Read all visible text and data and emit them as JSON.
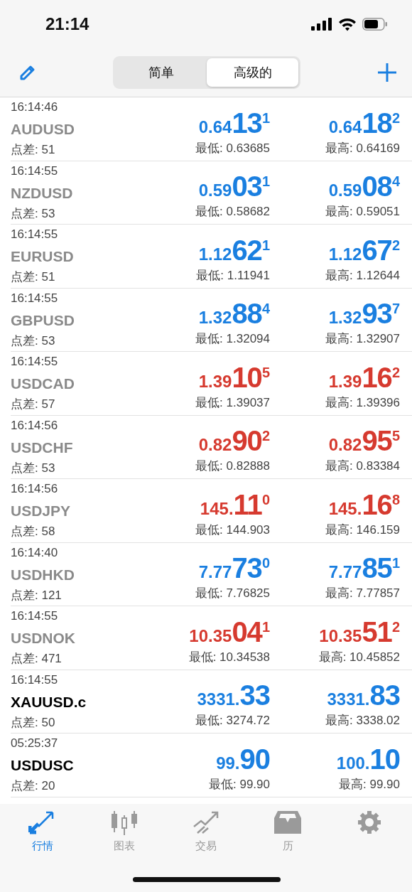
{
  "status_bar": {
    "time": "21:14"
  },
  "segments": [
    {
      "label": "简单",
      "selected": false
    },
    {
      "label": "高级的",
      "selected": true
    }
  ],
  "quotes": [
    {
      "time": "16:14:46",
      "symbol": "AUDUSD",
      "active": false,
      "spread": "点差: 51",
      "bid": {
        "color": "#1a7fe0",
        "prefix": "0.64",
        "big": "13",
        "sup": "1"
      },
      "ask": {
        "color": "#1a7fe0",
        "prefix": "0.64",
        "big": "18",
        "sup": "2"
      },
      "low": "最低: 0.63685",
      "high": "最高: 0.64169"
    },
    {
      "time": "16:14:55",
      "symbol": "NZDUSD",
      "active": false,
      "spread": "点差: 53",
      "bid": {
        "color": "#1a7fe0",
        "prefix": "0.59",
        "big": "03",
        "sup": "1"
      },
      "ask": {
        "color": "#1a7fe0",
        "prefix": "0.59",
        "big": "08",
        "sup": "4"
      },
      "low": "最低: 0.58682",
      "high": "最高: 0.59051"
    },
    {
      "time": "16:14:55",
      "symbol": "EURUSD",
      "active": false,
      "spread": "点差: 51",
      "bid": {
        "color": "#1a7fe0",
        "prefix": "1.12",
        "big": "62",
        "sup": "1"
      },
      "ask": {
        "color": "#1a7fe0",
        "prefix": "1.12",
        "big": "67",
        "sup": "2"
      },
      "low": "最低: 1.11941",
      "high": "最高: 1.12644"
    },
    {
      "time": "16:14:55",
      "symbol": "GBPUSD",
      "active": false,
      "spread": "点差: 53",
      "bid": {
        "color": "#1a7fe0",
        "prefix": "1.32",
        "big": "88",
        "sup": "4"
      },
      "ask": {
        "color": "#1a7fe0",
        "prefix": "1.32",
        "big": "93",
        "sup": "7"
      },
      "low": "最低: 1.32094",
      "high": "最高: 1.32907"
    },
    {
      "time": "16:14:55",
      "symbol": "USDCAD",
      "active": false,
      "spread": "点差: 57",
      "bid": {
        "color": "#d63a2f",
        "prefix": "1.39",
        "big": "10",
        "sup": "5"
      },
      "ask": {
        "color": "#d63a2f",
        "prefix": "1.39",
        "big": "16",
        "sup": "2"
      },
      "low": "最低: 1.39037",
      "high": "最高: 1.39396"
    },
    {
      "time": "16:14:56",
      "symbol": "USDCHF",
      "active": false,
      "spread": "点差: 53",
      "bid": {
        "color": "#d63a2f",
        "prefix": "0.82",
        "big": "90",
        "sup": "2"
      },
      "ask": {
        "color": "#d63a2f",
        "prefix": "0.82",
        "big": "95",
        "sup": "5"
      },
      "low": "最低: 0.82888",
      "high": "最高: 0.83384"
    },
    {
      "time": "16:14:56",
      "symbol": "USDJPY",
      "active": false,
      "spread": "点差: 58",
      "bid": {
        "color": "#d63a2f",
        "prefix": "145.",
        "big": "11",
        "sup": "0"
      },
      "ask": {
        "color": "#d63a2f",
        "prefix": "145.",
        "big": "16",
        "sup": "8"
      },
      "low": "最低: 144.903",
      "high": "最高: 146.159"
    },
    {
      "time": "16:14:40",
      "symbol": "USDHKD",
      "active": false,
      "spread": "点差: 121",
      "bid": {
        "color": "#1a7fe0",
        "prefix": "7.77",
        "big": "73",
        "sup": "0"
      },
      "ask": {
        "color": "#1a7fe0",
        "prefix": "7.77",
        "big": "85",
        "sup": "1"
      },
      "low": "最低: 7.76825",
      "high": "最高: 7.77857"
    },
    {
      "time": "16:14:55",
      "symbol": "USDNOK",
      "active": false,
      "spread": "点差: 471",
      "bid": {
        "color": "#d63a2f",
        "prefix": "10.35",
        "big": "04",
        "sup": "1"
      },
      "ask": {
        "color": "#d63a2f",
        "prefix": "10.35",
        "big": "51",
        "sup": "2"
      },
      "low": "最低: 10.34538",
      "high": "最高: 10.45852"
    },
    {
      "time": "16:14:55",
      "symbol": "XAUUSD.c",
      "active": true,
      "spread": "点差: 50",
      "bid": {
        "color": "#1a7fe0",
        "prefix": "3331.",
        "big": "33"
      },
      "ask": {
        "color": "#1a7fe0",
        "prefix": "3331.",
        "big": "83"
      },
      "low": "最低: 3274.72",
      "high": "最高: 3338.02"
    },
    {
      "time": "05:25:37",
      "symbol": "USDUSC",
      "active": true,
      "spread": "点差: 20",
      "bid": {
        "color": "#1a7fe0",
        "prefix": "99.",
        "big": "90"
      },
      "ask": {
        "color": "#1a7fe0",
        "prefix": "100.",
        "big": "10"
      },
      "low": "最低: 99.90",
      "high": "最高: 99.90"
    }
  ],
  "tab_bar": [
    {
      "kind": "quotes",
      "label": "行情",
      "selected": true
    },
    {
      "kind": "chart",
      "label": "图表",
      "selected": false
    },
    {
      "kind": "trade",
      "label": "交易",
      "selected": false
    },
    {
      "kind": "history",
      "label": "历",
      "selected": false
    },
    {
      "kind": "settings",
      "selected": false
    }
  ]
}
